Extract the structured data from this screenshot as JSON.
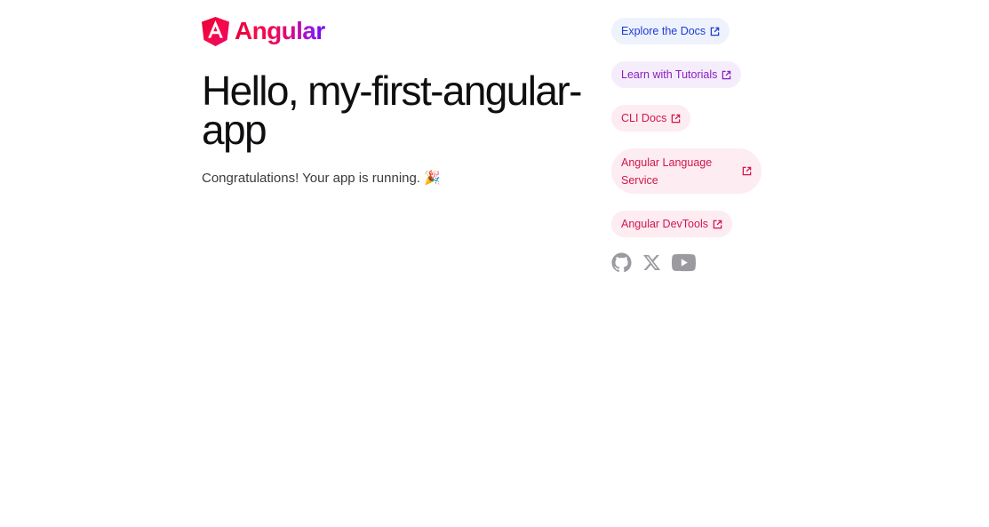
{
  "brand": {
    "name": "Angular"
  },
  "main": {
    "title": "Hello, my-first-angular-app",
    "subtitle": "Congratulations! Your app is running. 🎉"
  },
  "links": [
    {
      "label": "Explore the Docs",
      "color": "#1d3bd6",
      "bg": "#eef2fd"
    },
    {
      "label": "Learn with Tutorials",
      "color": "#8a1fc2",
      "bg": "#f5edfb"
    },
    {
      "label": "CLI Docs",
      "color": "#d0174e",
      "bg": "#fdecf1"
    },
    {
      "label": "Angular Language Service",
      "color": "#d0174e",
      "bg": "#fdecf1"
    },
    {
      "label": "Angular DevTools",
      "color": "#d0174e",
      "bg": "#fdecf1"
    }
  ],
  "social": [
    {
      "icon": "github-icon"
    },
    {
      "icon": "x-icon"
    },
    {
      "icon": "youtube-icon"
    }
  ],
  "colors": {
    "icon_gray": "#9a9a9f",
    "logo_red": "#e40035"
  }
}
